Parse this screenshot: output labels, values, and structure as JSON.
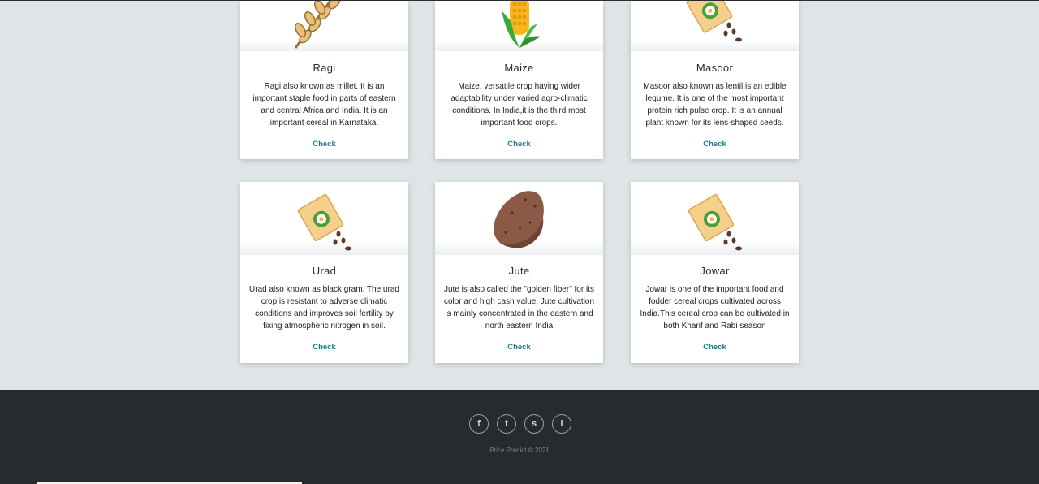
{
  "crops": [
    {
      "name": "Ragi",
      "desc": "Ragi also known as millet. It is an important staple food in parts of eastern and central Africa and India. It is an important cereal in Karnataka.",
      "button": "Check",
      "icon": "wheat-icon"
    },
    {
      "name": "Maize",
      "desc": "Maize, versatile crop having wider adaptability under varied agro-climatic conditions. In India,it is the third most important food crops.",
      "button": "Check",
      "icon": "corn-icon"
    },
    {
      "name": "Masoor",
      "desc": "Masoor also known as lentil,is an edible legume. It is one of the most important protein rich pulse crop. It is an annual plant known for its lens-shaped seeds.",
      "button": "Check",
      "icon": "seed-packet-icon"
    },
    {
      "name": "Urad",
      "desc": "Urad also known as black gram. The urad crop is resistant to adverse climatic conditions and improves soil fertility by fixing atmospheric nitrogen in soil.",
      "button": "Check",
      "icon": "seed-packet-icon"
    },
    {
      "name": "Jute",
      "desc": "Jute is also called the \"golden fiber\" for its color and high cash value. Jute cultivation is mainly concentrated in the eastern and north eastern India",
      "button": "Check",
      "icon": "potato-icon"
    },
    {
      "name": "Jowar",
      "desc": "Jowar is one of the important food and fodder cereal crops cultivated across India.This cereal crop can be cultivated in both Kharif and Rabi season",
      "button": "Check",
      "icon": "seed-packet-icon"
    }
  ],
  "footer": {
    "social": [
      {
        "icon": "facebook-icon",
        "glyph": "f"
      },
      {
        "icon": "twitter-icon",
        "glyph": "t"
      },
      {
        "icon": "snapchat-icon",
        "glyph": "s"
      },
      {
        "icon": "instagram-icon",
        "glyph": "i"
      }
    ],
    "copyright": "Price Predict © 2021"
  },
  "colors": {
    "background": "#dfe5e7",
    "footer": "#262b30",
    "link": "#1a7f8a"
  }
}
